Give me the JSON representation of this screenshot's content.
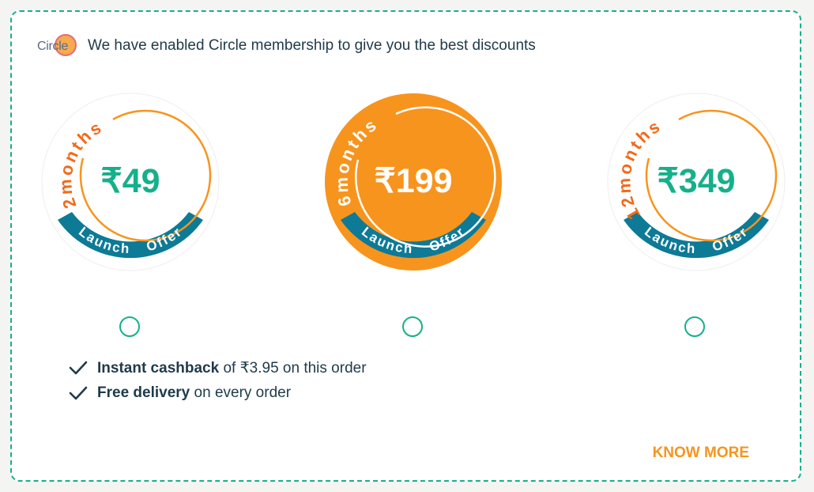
{
  "header": {
    "logo_text": "Circle",
    "message": "We have enabled Circle membership to give you the best discounts"
  },
  "plans": [
    {
      "duration": "2months",
      "price": "₹49",
      "ribbon_left": "Launch",
      "ribbon_right": "Offer",
      "selected": false
    },
    {
      "duration": "6months",
      "price": "₹199",
      "ribbon_left": "Launch",
      "ribbon_right": "Offer",
      "selected": true
    },
    {
      "duration": "12months",
      "price": "₹349",
      "ribbon_left": "Launch",
      "ribbon_right": "Offer",
      "selected": false
    }
  ],
  "benefits": [
    {
      "bold": "Instant cashback",
      "rest": " of ₹3.95 on this order"
    },
    {
      "bold": "Free delivery",
      "rest": " on every order"
    }
  ],
  "know_more_label": "KNOW MORE",
  "colors": {
    "border": "#16b08a",
    "orange": "#f7941d",
    "price_green": "#16b08a",
    "ribbon_blue": "#0d7a96",
    "duration_text": "#f26a1b"
  },
  "icons": {
    "check": "check-icon",
    "radio": "radio-button"
  }
}
